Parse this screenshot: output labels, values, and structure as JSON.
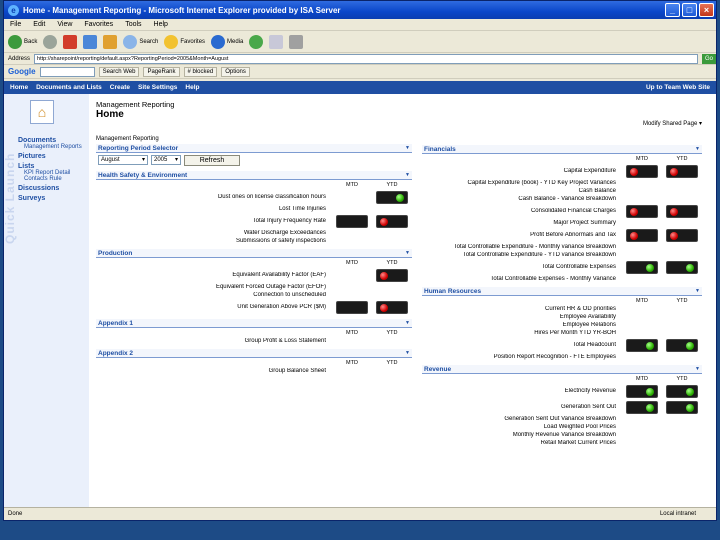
{
  "window": {
    "title": "Home - Management Reporting - Microsoft Internet Explorer provided by ISA Server"
  },
  "menu": [
    "File",
    "Edit",
    "View",
    "Favorites",
    "Tools",
    "Help"
  ],
  "toolbar": {
    "back": "Back",
    "search": "Search",
    "favorites": "Favorites",
    "media": "Media"
  },
  "address": {
    "label": "Address",
    "value": "http://sharepoint/reporting/default.aspx?ReportingPeriod=2005&Month=August",
    "go": "Go"
  },
  "google": {
    "logo": "Google",
    "search_web": "Search Web",
    "pagerank": "PageRank",
    "blocked": "# blocked",
    "options": "Options"
  },
  "sp_nav": {
    "items": [
      "Home",
      "Documents and Lists",
      "Create",
      "Site Settings",
      "Help"
    ],
    "up": "Up to Team Web Site"
  },
  "quicklaunch": {
    "vertical": "Quick Launch",
    "sections": [
      {
        "title": "Documents",
        "subs": [
          "Management Reports"
        ]
      },
      {
        "title": "Pictures",
        "subs": []
      },
      {
        "title": "Lists",
        "subs": [
          "KPI Report Detail",
          "Contacts Rule"
        ]
      },
      {
        "title": "Discussions",
        "subs": []
      },
      {
        "title": "Surveys",
        "subs": []
      }
    ]
  },
  "page": {
    "site": "Management Reporting",
    "title": "Home",
    "modify": "Modify Shared Page ▾",
    "sub": "Management Reporting"
  },
  "period": {
    "title": "Reporting Period Selector",
    "month": "August",
    "year": "2005",
    "refresh": "Refresh"
  },
  "hse": {
    "title": "Health Safety & Environment",
    "mtd": "MTD",
    "ytd": "YTD",
    "rows": [
      {
        "label": "Dust ones on license classification hours",
        "mtd": "",
        "ytd": "green"
      },
      {
        "label": "Lost Time Injuries",
        "mtd": "",
        "ytd": ""
      },
      {
        "label": "Total Injury Frequency Rate",
        "mtd": "off",
        "ytd": "red"
      },
      {
        "label": "Water Discharge Exceedances",
        "mtd": "",
        "ytd": ""
      },
      {
        "label": "Submissions of safety inspections",
        "mtd": "",
        "ytd": ""
      }
    ]
  },
  "production": {
    "title": "Production",
    "mtd": "MTD",
    "ytd": "YTD",
    "rows": [
      {
        "label": "Equivalent Availability Factor (EAF)",
        "mtd": "",
        "ytd": "red"
      },
      {
        "label": "Equivalent Forced Outage Factor (EFOF)",
        "mtd": "",
        "ytd": ""
      },
      {
        "label": "Connection to unscheduled",
        "mtd": "",
        "ytd": ""
      },
      {
        "label": "Unit Generation Above PCR ($M)",
        "mtd": "off",
        "ytd": "red"
      }
    ]
  },
  "appendix1": {
    "title": "Appendix 1",
    "mtd": "MTD",
    "ytd": "YTD",
    "rows": [
      {
        "label": "Group Profit & Loss Statement"
      }
    ]
  },
  "appendix2": {
    "title": "Appendix 2",
    "mtd": "MTD",
    "ytd": "YTD",
    "rows": [
      {
        "label": "Group Balance Sheet"
      }
    ]
  },
  "financials": {
    "title": "Financials",
    "mtd": "MTD",
    "ytd": "YTD",
    "rows": [
      {
        "label": "Capital Expenditure",
        "mtd": "red",
        "ytd": "red"
      },
      {
        "label": "Capital Expenditure (book) - YTD Key Project Variances",
        "mtd": "",
        "ytd": ""
      },
      {
        "label": "Cash Balance",
        "mtd": "",
        "ytd": ""
      },
      {
        "label": "Cash Balance - Variance Breakdown",
        "mtd": "",
        "ytd": ""
      },
      {
        "label": "Consolidated Financial Charges",
        "mtd": "red",
        "ytd": "red"
      },
      {
        "label": "Major Project Summary",
        "mtd": "",
        "ytd": ""
      },
      {
        "label": "Profit Before Abnormals and Tax",
        "mtd": "red",
        "ytd": "red"
      },
      {
        "label": "Total Controllable Expenditure - Monthly variance Breakdown",
        "mtd": "",
        "ytd": ""
      },
      {
        "label": "Total Controllable Expenditure - YTD variance Breakdown",
        "mtd": "",
        "ytd": ""
      },
      {
        "label": "Total Controllable Expenses",
        "mtd": "green",
        "ytd": "green"
      },
      {
        "label": "Total Controllable Expenses - Monthly Variance",
        "mtd": "",
        "ytd": ""
      }
    ]
  },
  "hr": {
    "title": "Human Resources",
    "mtd": "MTD",
    "ytd": "YTD",
    "rows": [
      {
        "label": "Current HR & OD priorities",
        "mtd": "",
        "ytd": ""
      },
      {
        "label": "Employee Availability",
        "mtd": "",
        "ytd": ""
      },
      {
        "label": "Employee Relations",
        "mtd": "",
        "ytd": ""
      },
      {
        "label": "Hires Per Month YTD YR-BOH",
        "mtd": "",
        "ytd": ""
      },
      {
        "label": "Total Headcount",
        "mtd": "green",
        "ytd": "green"
      },
      {
        "label": "Position Report Recognition - FTE Employees",
        "mtd": "",
        "ytd": ""
      }
    ]
  },
  "revenue": {
    "title": "Revenue",
    "mtd": "MTD",
    "ytd": "YTD",
    "rows": [
      {
        "label": "Electricity Revenue",
        "mtd": "green",
        "ytd": "green"
      },
      {
        "label": "Generation Sent Out",
        "mtd": "green",
        "ytd": "green"
      },
      {
        "label": "Generation Sent Out Variance Breakdown",
        "mtd": "",
        "ytd": ""
      },
      {
        "label": "Load Weighted Pool Prices",
        "mtd": "",
        "ytd": ""
      },
      {
        "label": "Monthly Revenue Variance Breakdown",
        "mtd": "",
        "ytd": ""
      },
      {
        "label": "Retail Market Current Prices",
        "mtd": "",
        "ytd": ""
      }
    ]
  },
  "status": {
    "left": "Done",
    "zone": "Local intranet"
  }
}
